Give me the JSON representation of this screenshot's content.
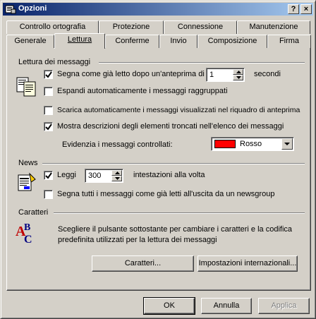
{
  "window": {
    "title": "Opzioni",
    "help_button": "?",
    "close_button": "×"
  },
  "tabs_back": [
    "Controllo ortografia",
    "Protezione",
    "Connessione",
    "Manutenzione"
  ],
  "tabs_front": [
    "Generale",
    "Lettura",
    "Conferme",
    "Invio",
    "Composizione",
    "Firma"
  ],
  "active_tab": "Lettura",
  "lettura": {
    "section_title": "Lettura dei messaggi",
    "mark_read": {
      "label": "Segna come già letto dopo un'anteprima di",
      "checked": true,
      "value": "1",
      "unit": "secondi"
    },
    "expand_groups": {
      "label": "Espandi automaticamente i messaggi raggruppati",
      "checked": false
    },
    "auto_download": {
      "label": "Scarica automaticamente i messaggi visualizzati nel riquadro di anteprima",
      "checked": false
    },
    "show_tooltips": {
      "label": "Mostra descrizioni degli elementi troncati nell'elenco dei messaggi",
      "checked": true
    },
    "highlight": {
      "label": "Evidenzia i messaggi controllati:",
      "color_name": "Rosso",
      "color_hex": "#ff0000"
    }
  },
  "news": {
    "section_title": "News",
    "get": {
      "label": "Leggi",
      "checked": true,
      "value": "300",
      "suffix": "intestazioni alla volta"
    },
    "mark_all_read": {
      "label": "Segna tutti i messaggi come già letti all'uscita da un newsgroup",
      "checked": false
    }
  },
  "fonts": {
    "section_title": "Caratteri",
    "description": "Scegliere il pulsante sottostante per cambiare i caratteri e la codifica predefinita utilizzati per la lettura dei messaggi",
    "fonts_button": "Caratteri...",
    "intl_button": "Impostazioni internazionali..."
  },
  "footer": {
    "ok": "OK",
    "cancel": "Annulla",
    "apply": "Applica"
  }
}
